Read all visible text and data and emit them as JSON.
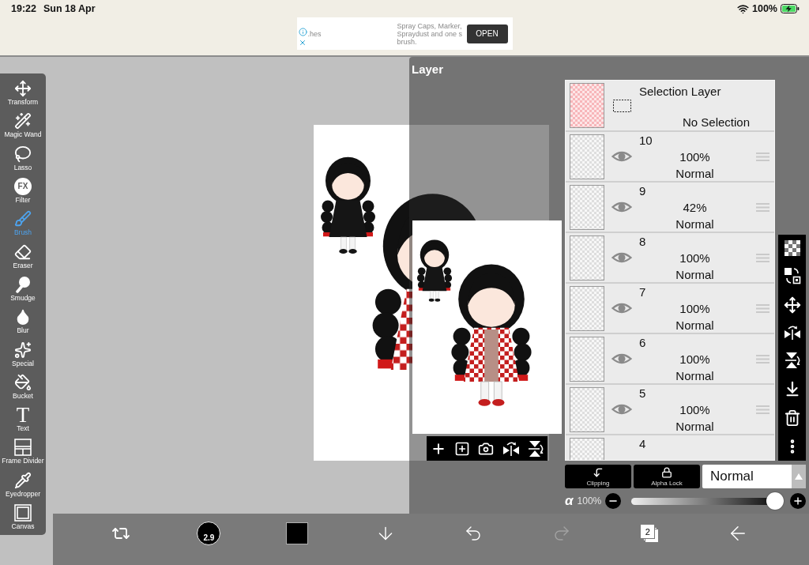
{
  "status_bar": {
    "time": "19:22",
    "date": "Sun 18 Apr",
    "battery": "100%",
    "charging": true
  },
  "ad": {
    "snippet": ".hes",
    "lines": [
      "Spray Caps, Marker,",
      "Spraydust and one s",
      "brush."
    ],
    "button": "OPEN"
  },
  "tools": [
    {
      "kind": "transform",
      "label": "Transform",
      "selected": false
    },
    {
      "kind": "magic_wand",
      "label": "Magic Wand",
      "selected": false
    },
    {
      "kind": "lasso",
      "label": "Lasso",
      "selected": false
    },
    {
      "kind": "filter",
      "glyph": "FX",
      "label": "Filter",
      "selected": false
    },
    {
      "kind": "brush",
      "label": "Brush",
      "selected": true
    },
    {
      "kind": "eraser",
      "label": "Eraser",
      "selected": false
    },
    {
      "kind": "smudge",
      "label": "Smudge",
      "selected": false
    },
    {
      "kind": "blur",
      "label": "Blur",
      "selected": false
    },
    {
      "kind": "special",
      "label": "Special",
      "selected": false
    },
    {
      "kind": "bucket",
      "label": "Bucket",
      "selected": false
    },
    {
      "kind": "text",
      "glyph": "T",
      "label": "Text",
      "selected": false
    },
    {
      "kind": "frame_divider",
      "label": "Frame Divider",
      "selected": false
    },
    {
      "kind": "eyedropper",
      "label": "Eyedropper",
      "selected": false
    },
    {
      "kind": "canvas",
      "label": "Canvas",
      "selected": false
    }
  ],
  "layer_panel": {
    "title": "Layer",
    "selection_layer": {
      "name": "Selection Layer",
      "status": "No Selection"
    },
    "layers": [
      {
        "name": "10",
        "opacity": "100%",
        "blend": "Normal",
        "visible": true
      },
      {
        "name": "9",
        "opacity": "42%",
        "blend": "Normal",
        "visible": true
      },
      {
        "name": "8",
        "opacity": "100%",
        "blend": "Normal",
        "visible": true
      },
      {
        "name": "7",
        "opacity": "100%",
        "blend": "Normal",
        "visible": true
      },
      {
        "name": "6",
        "opacity": "100%",
        "blend": "Normal",
        "visible": true
      },
      {
        "name": "5",
        "opacity": "100%",
        "blend": "Normal",
        "visible": true
      },
      {
        "name": "4"
      }
    ],
    "buttons": [
      {
        "kind": "clipping",
        "label": "Clipping"
      },
      {
        "kind": "alpha_lock",
        "label": "Alpha Lock"
      }
    ],
    "blend_mode": "Normal",
    "opacity": {
      "symbol": "α",
      "reading": "100%",
      "level": 1
    }
  },
  "bottom_toolbar": [
    {
      "kind": "swap"
    },
    {
      "kind": "brush_size",
      "label": "2.9"
    },
    {
      "kind": "color",
      "color": "#000000"
    },
    {
      "kind": "download"
    },
    {
      "kind": "undo",
      "disabled": false
    },
    {
      "kind": "redo",
      "disabled": true
    },
    {
      "kind": "layers",
      "label": "2"
    },
    {
      "kind": "back"
    }
  ]
}
